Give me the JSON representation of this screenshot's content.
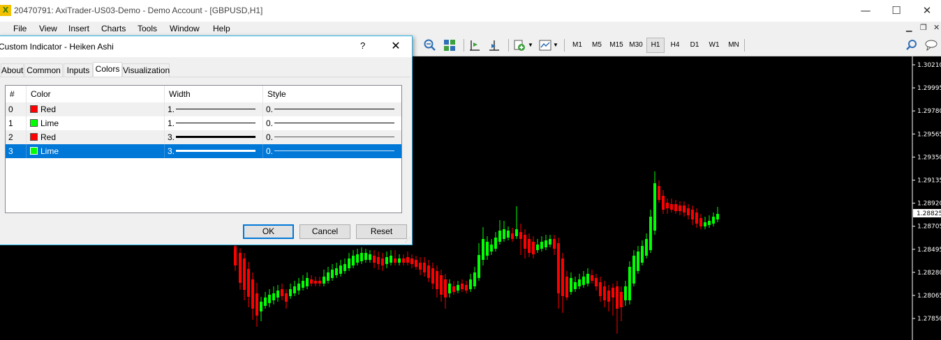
{
  "window": {
    "title": "20470791: AxiTrader-US03-Demo - Demo Account - [GBPUSD,H1]",
    "app_icon": "X",
    "minimize": "—",
    "maximize": "☐",
    "close": "✕"
  },
  "menu": {
    "items": [
      "File",
      "View",
      "Insert",
      "Charts",
      "Tools",
      "Window",
      "Help"
    ],
    "mdi_minimize": "▁",
    "mdi_restore": "❐",
    "mdi_close": "✕"
  },
  "toolbar": {
    "timeframes": [
      "M1",
      "M5",
      "M15",
      "M30",
      "H1",
      "H4",
      "D1",
      "W1",
      "MN"
    ],
    "active_timeframe": "H1"
  },
  "chart": {
    "background": "#000000",
    "bull_color": "#00ff00",
    "bear_color": "#ff0000",
    "price_axis": [
      "1.30210",
      "1.29995",
      "1.29780",
      "1.29565",
      "1.29350",
      "1.29135",
      "1.28920",
      "1.28705",
      "1.28495",
      "1.28280",
      "1.28065",
      "1.27850"
    ],
    "current_price": "1.28825"
  },
  "dialog": {
    "title": "Custom Indicator - Heiken Ashi",
    "help": "?",
    "close": "✕",
    "tabs": [
      "About",
      "Common",
      "Inputs",
      "Colors",
      "Visualization"
    ],
    "active_tab": "Colors",
    "grid": {
      "headers": [
        "#",
        "Color",
        "Width",
        "Style"
      ],
      "rows": [
        {
          "index": "0",
          "color_name": "Red",
          "color": "#ff0000",
          "width": "1.",
          "style": "0."
        },
        {
          "index": "1",
          "color_name": "Lime",
          "color": "#00ff00",
          "width": "1.",
          "style": "0."
        },
        {
          "index": "2",
          "color_name": "Red",
          "color": "#ff0000",
          "width": "3.",
          "style": "0."
        },
        {
          "index": "3",
          "color_name": "Lime",
          "color": "#00ff00",
          "width": "3.",
          "style": "0."
        }
      ],
      "selected_row": 3
    },
    "buttons": {
      "ok": "OK",
      "cancel": "Cancel",
      "reset": "Reset"
    }
  }
}
